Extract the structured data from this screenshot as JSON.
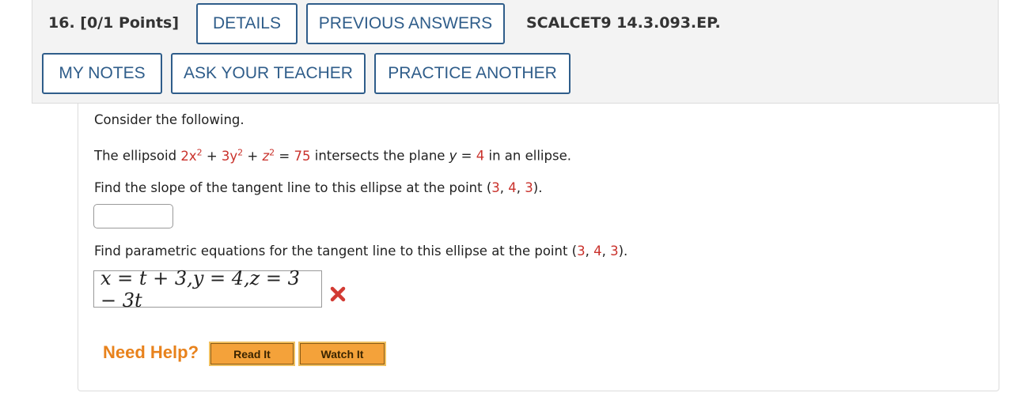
{
  "header": {
    "question_label": "16.  [0/1 Points]",
    "details_label": "DETAILS",
    "previous_answers_label": "PREVIOUS ANSWERS",
    "code": "SCALCET9 14.3.093.EP.",
    "my_notes_label": "MY NOTES",
    "ask_teacher_label": "ASK YOUR TEACHER",
    "practice_another_label": "PRACTICE ANOTHER"
  },
  "problem": {
    "intro": "Consider the following.",
    "statement": {
      "pre": "The ellipsoid ",
      "eq_a": "2x",
      "eq_a_exp": "2",
      "eq_plus1": " + ",
      "eq_b": "3y",
      "eq_b_exp": "2",
      "eq_plus2": " + ",
      "eq_c": "z",
      "eq_c_exp": "2",
      "eq_equals": " = ",
      "eq_rhs": "75",
      "mid": " intersects the plane ",
      "plane_var": "y",
      "plane_equals": " = ",
      "plane_value": "4",
      "post": " in an ellipse."
    },
    "part1": {
      "pre": "Find the slope of the tangent line to this ellipse at the point (",
      "p1": "3",
      "sep1": ", ",
      "p2": "4",
      "sep2": ", ",
      "p3": "3",
      "post": ").",
      "answer_value": ""
    },
    "part2": {
      "pre": "Find parametric equations for the tangent line to this ellipse at the point (",
      "p1": "3",
      "sep1": ", ",
      "p2": "4",
      "sep2": ", ",
      "p3": "3",
      "post": ").",
      "answer_value": "x = t + 3,y = 4,z = 3 − 3t",
      "status_icon": "incorrect-x-icon"
    }
  },
  "help": {
    "label": "Need Help?",
    "read_it_label": "Read It",
    "watch_it_label": "Watch It"
  },
  "colors": {
    "button_border": "#2f5d8a",
    "highlight_red": "#c9312b",
    "help_orange": "#e8821c",
    "help_button": "#f4a23a",
    "header_bg": "#f3f3f3"
  }
}
